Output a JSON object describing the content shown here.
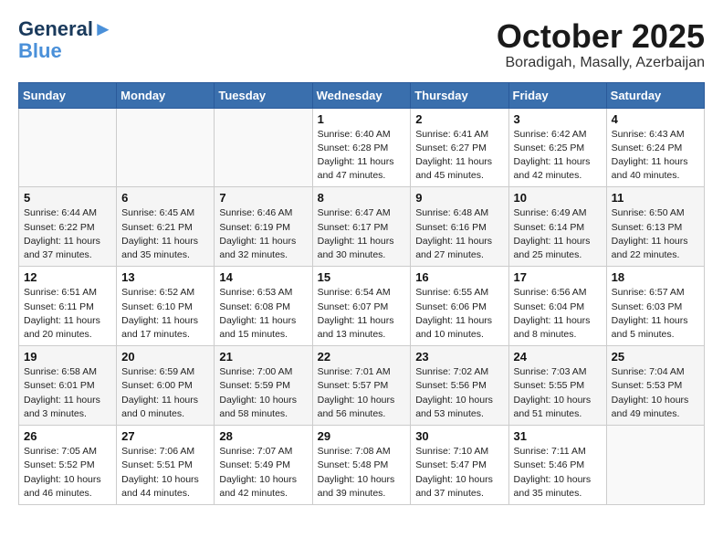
{
  "header": {
    "logo_line1": "General",
    "logo_line2": "Blue",
    "month_title": "October 2025",
    "location": "Boradigah, Masally, Azerbaijan"
  },
  "days_of_week": [
    "Sunday",
    "Monday",
    "Tuesday",
    "Wednesday",
    "Thursday",
    "Friday",
    "Saturday"
  ],
  "weeks": [
    [
      {
        "day": "",
        "info": ""
      },
      {
        "day": "",
        "info": ""
      },
      {
        "day": "",
        "info": ""
      },
      {
        "day": "1",
        "info": "Sunrise: 6:40 AM\nSunset: 6:28 PM\nDaylight: 11 hours\nand 47 minutes."
      },
      {
        "day": "2",
        "info": "Sunrise: 6:41 AM\nSunset: 6:27 PM\nDaylight: 11 hours\nand 45 minutes."
      },
      {
        "day": "3",
        "info": "Sunrise: 6:42 AM\nSunset: 6:25 PM\nDaylight: 11 hours\nand 42 minutes."
      },
      {
        "day": "4",
        "info": "Sunrise: 6:43 AM\nSunset: 6:24 PM\nDaylight: 11 hours\nand 40 minutes."
      }
    ],
    [
      {
        "day": "5",
        "info": "Sunrise: 6:44 AM\nSunset: 6:22 PM\nDaylight: 11 hours\nand 37 minutes."
      },
      {
        "day": "6",
        "info": "Sunrise: 6:45 AM\nSunset: 6:21 PM\nDaylight: 11 hours\nand 35 minutes."
      },
      {
        "day": "7",
        "info": "Sunrise: 6:46 AM\nSunset: 6:19 PM\nDaylight: 11 hours\nand 32 minutes."
      },
      {
        "day": "8",
        "info": "Sunrise: 6:47 AM\nSunset: 6:17 PM\nDaylight: 11 hours\nand 30 minutes."
      },
      {
        "day": "9",
        "info": "Sunrise: 6:48 AM\nSunset: 6:16 PM\nDaylight: 11 hours\nand 27 minutes."
      },
      {
        "day": "10",
        "info": "Sunrise: 6:49 AM\nSunset: 6:14 PM\nDaylight: 11 hours\nand 25 minutes."
      },
      {
        "day": "11",
        "info": "Sunrise: 6:50 AM\nSunset: 6:13 PM\nDaylight: 11 hours\nand 22 minutes."
      }
    ],
    [
      {
        "day": "12",
        "info": "Sunrise: 6:51 AM\nSunset: 6:11 PM\nDaylight: 11 hours\nand 20 minutes."
      },
      {
        "day": "13",
        "info": "Sunrise: 6:52 AM\nSunset: 6:10 PM\nDaylight: 11 hours\nand 17 minutes."
      },
      {
        "day": "14",
        "info": "Sunrise: 6:53 AM\nSunset: 6:08 PM\nDaylight: 11 hours\nand 15 minutes."
      },
      {
        "day": "15",
        "info": "Sunrise: 6:54 AM\nSunset: 6:07 PM\nDaylight: 11 hours\nand 13 minutes."
      },
      {
        "day": "16",
        "info": "Sunrise: 6:55 AM\nSunset: 6:06 PM\nDaylight: 11 hours\nand 10 minutes."
      },
      {
        "day": "17",
        "info": "Sunrise: 6:56 AM\nSunset: 6:04 PM\nDaylight: 11 hours\nand 8 minutes."
      },
      {
        "day": "18",
        "info": "Sunrise: 6:57 AM\nSunset: 6:03 PM\nDaylight: 11 hours\nand 5 minutes."
      }
    ],
    [
      {
        "day": "19",
        "info": "Sunrise: 6:58 AM\nSunset: 6:01 PM\nDaylight: 11 hours\nand 3 minutes."
      },
      {
        "day": "20",
        "info": "Sunrise: 6:59 AM\nSunset: 6:00 PM\nDaylight: 11 hours\nand 0 minutes."
      },
      {
        "day": "21",
        "info": "Sunrise: 7:00 AM\nSunset: 5:59 PM\nDaylight: 10 hours\nand 58 minutes."
      },
      {
        "day": "22",
        "info": "Sunrise: 7:01 AM\nSunset: 5:57 PM\nDaylight: 10 hours\nand 56 minutes."
      },
      {
        "day": "23",
        "info": "Sunrise: 7:02 AM\nSunset: 5:56 PM\nDaylight: 10 hours\nand 53 minutes."
      },
      {
        "day": "24",
        "info": "Sunrise: 7:03 AM\nSunset: 5:55 PM\nDaylight: 10 hours\nand 51 minutes."
      },
      {
        "day": "25",
        "info": "Sunrise: 7:04 AM\nSunset: 5:53 PM\nDaylight: 10 hours\nand 49 minutes."
      }
    ],
    [
      {
        "day": "26",
        "info": "Sunrise: 7:05 AM\nSunset: 5:52 PM\nDaylight: 10 hours\nand 46 minutes."
      },
      {
        "day": "27",
        "info": "Sunrise: 7:06 AM\nSunset: 5:51 PM\nDaylight: 10 hours\nand 44 minutes."
      },
      {
        "day": "28",
        "info": "Sunrise: 7:07 AM\nSunset: 5:49 PM\nDaylight: 10 hours\nand 42 minutes."
      },
      {
        "day": "29",
        "info": "Sunrise: 7:08 AM\nSunset: 5:48 PM\nDaylight: 10 hours\nand 39 minutes."
      },
      {
        "day": "30",
        "info": "Sunrise: 7:10 AM\nSunset: 5:47 PM\nDaylight: 10 hours\nand 37 minutes."
      },
      {
        "day": "31",
        "info": "Sunrise: 7:11 AM\nSunset: 5:46 PM\nDaylight: 10 hours\nand 35 minutes."
      },
      {
        "day": "",
        "info": ""
      }
    ]
  ]
}
